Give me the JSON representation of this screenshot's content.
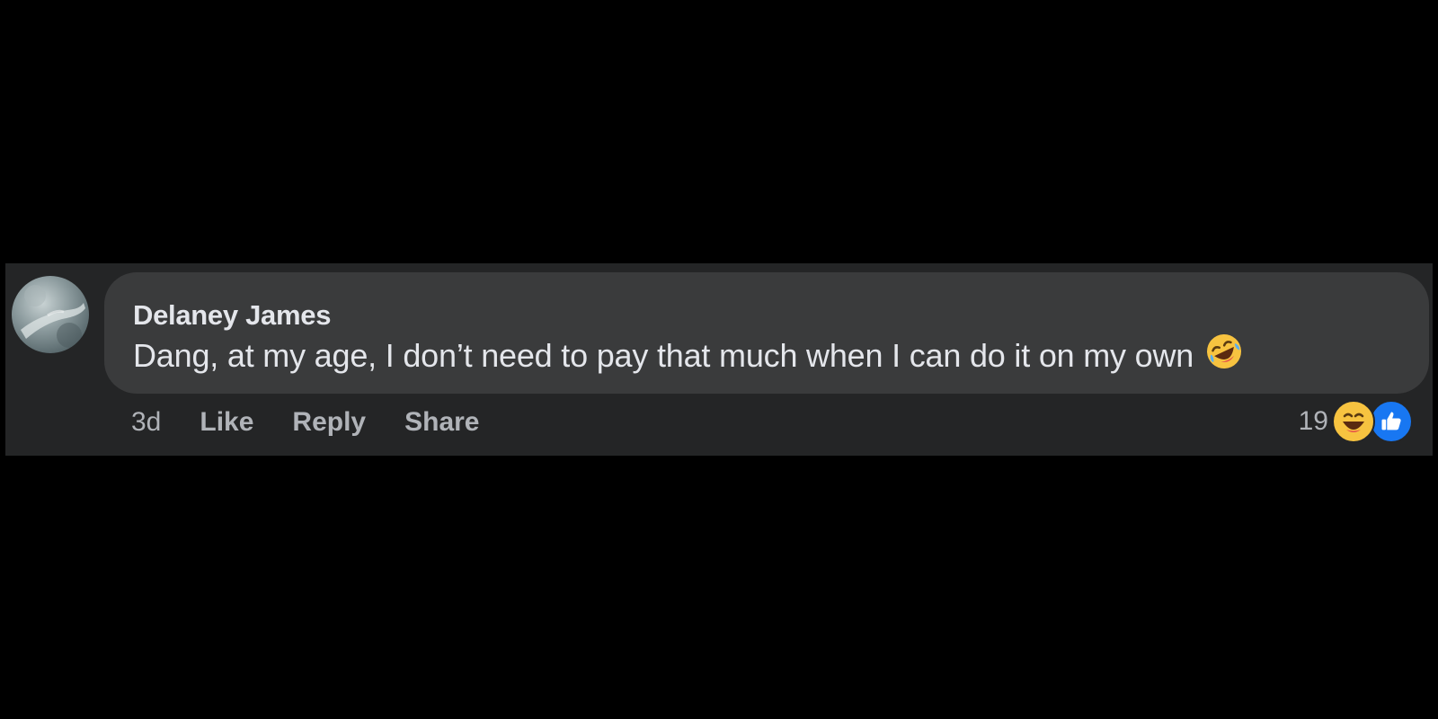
{
  "comment": {
    "author": "Delaney James",
    "text": "Dang, at my age, I don’t need to pay that much when I can do it on my own",
    "text_emoji": "rolling-on-floor-laughing-emoji",
    "timestamp": "3d",
    "actions": {
      "like_label": "Like",
      "reply_label": "Reply",
      "share_label": "Share"
    },
    "reactions": {
      "count": "19",
      "types": [
        "haha",
        "like"
      ]
    }
  },
  "colors": {
    "page_background": "#000000",
    "comment_background": "#242526",
    "bubble_background": "#3a3b3c",
    "primary_text": "#e4e6eb",
    "secondary_text": "#b0b3b8",
    "like_blue": "#1877f2",
    "haha_yellow": "#f7c340"
  }
}
